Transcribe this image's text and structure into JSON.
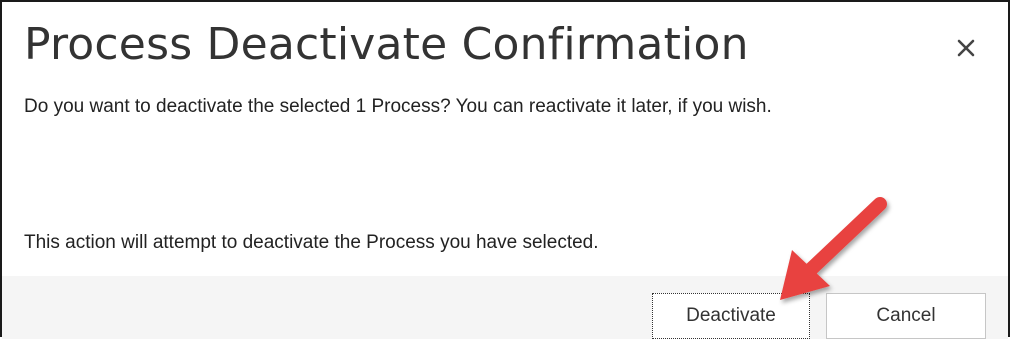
{
  "dialog": {
    "title": "Process Deactivate Confirmation",
    "close_icon": "close-icon",
    "message": "Do you want to deactivate the selected 1 Process? You can reactivate it later, if you wish.",
    "detail": "This action will attempt to deactivate the Process you have selected."
  },
  "buttons": {
    "deactivate_label": "Deactivate",
    "cancel_label": "Cancel"
  },
  "annotation": {
    "arrow_icon": "arrow-annotation-icon",
    "arrow_color": "#e8423f"
  },
  "colors": {
    "footer_background": "#f5f5f5",
    "border": "#1a1a1a"
  }
}
